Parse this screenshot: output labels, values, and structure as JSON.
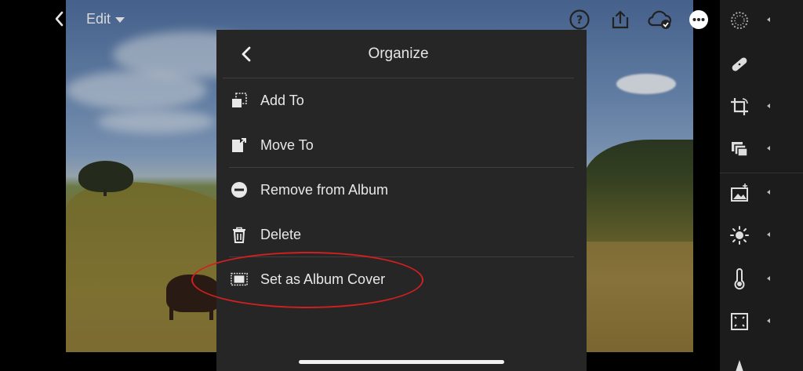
{
  "topbar": {
    "edit_label": "Edit"
  },
  "sheet": {
    "title": "Organize",
    "items": [
      {
        "label": "Add To",
        "icon": "add-to-icon"
      },
      {
        "label": "Move To",
        "icon": "move-to-icon"
      },
      {
        "label": "Remove from Album",
        "icon": "remove-icon"
      },
      {
        "label": "Delete",
        "icon": "trash-icon"
      },
      {
        "label": "Set as Album Cover",
        "icon": "album-cover-icon"
      }
    ]
  },
  "colors": {
    "sheet_bg": "#262626",
    "annotation": "#d21f1f",
    "toolbar_bg": "#1c1c1c"
  }
}
